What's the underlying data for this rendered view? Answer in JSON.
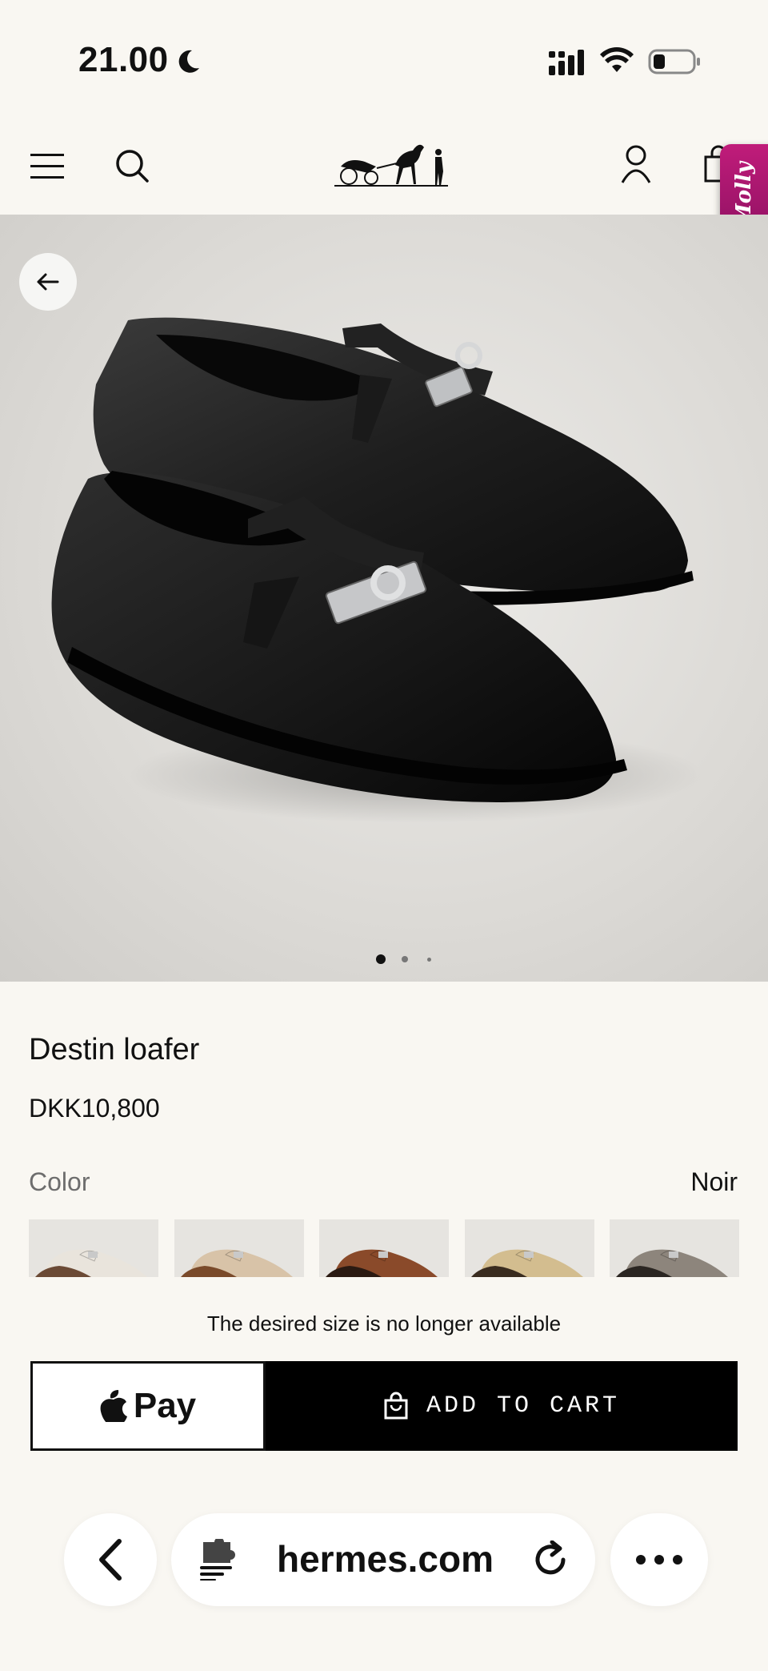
{
  "status_bar": {
    "time": "21.00"
  },
  "header": {
    "brand": "Hermès",
    "chat_tab_label": "Molly"
  },
  "gallery": {
    "slide_count": 3,
    "active_slide": 1
  },
  "product": {
    "name": "Destin loafer",
    "price": "DKK10,800",
    "color_label": "Color",
    "color_value": "Noir",
    "swatches": [
      {
        "name": "swatch-cream",
        "color": "#e9e4dc",
        "sole": "#6b4a35"
      },
      {
        "name": "swatch-beige-tan",
        "color": "#d8c3a8",
        "sole": "#7a4a2a"
      },
      {
        "name": "swatch-cognac",
        "color": "#8a4a2a",
        "sole": "#2b1a12"
      },
      {
        "name": "swatch-sand",
        "color": "#d3bd8f",
        "sole": "#3a2c1f"
      },
      {
        "name": "swatch-taupe",
        "color": "#8d857c",
        "sole": "#2b2622"
      }
    ],
    "availability_notice": "The desired size is no longer available"
  },
  "actions": {
    "apple_pay_label": "Pay",
    "add_to_cart_label": "ADD TO CART"
  },
  "browser": {
    "url": "hermes.com"
  }
}
